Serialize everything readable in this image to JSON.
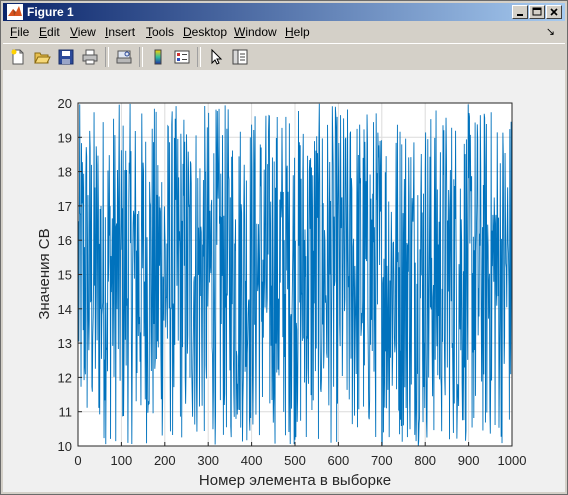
{
  "window": {
    "title": "Figure 1"
  },
  "menu": {
    "items": [
      {
        "label": "File",
        "accel": "F"
      },
      {
        "label": "Edit",
        "accel": "E"
      },
      {
        "label": "View",
        "accel": "V"
      },
      {
        "label": "Insert",
        "accel": "I"
      },
      {
        "label": "Tools",
        "accel": "T"
      },
      {
        "label": "Desktop",
        "accel": "D"
      },
      {
        "label": "Window",
        "accel": "W"
      },
      {
        "label": "Help",
        "accel": "H"
      }
    ]
  },
  "toolbar": {
    "buttons": [
      "new-figure-icon",
      "open-file-icon",
      "save-icon",
      "print-icon",
      "print-preview-icon",
      "colorbar-icon",
      "legend-icon",
      "edit-plot-arrow-icon",
      "property-editor-icon"
    ]
  },
  "colors": {
    "line": "#0072bd",
    "titlebar_start": "#0a246a",
    "titlebar_end": "#a6caf0"
  },
  "chart_data": {
    "type": "line",
    "title": "",
    "xlabel": "Номер элемента в выборке",
    "ylabel": "Значения СВ",
    "xlim": [
      0,
      1000
    ],
    "ylim": [
      10,
      20
    ],
    "xticks": [
      "0",
      "100",
      "200",
      "300",
      "400",
      "500",
      "600",
      "700",
      "800",
      "900",
      "1000"
    ],
    "yticks": [
      "10",
      "11",
      "12",
      "13",
      "14",
      "15",
      "16",
      "17",
      "18",
      "19",
      "20"
    ],
    "grid": true,
    "series": [
      {
        "name": "",
        "color": "#0072bd",
        "distribution": "uniform",
        "n": 1000,
        "range": [
          10,
          20
        ]
      }
    ]
  }
}
